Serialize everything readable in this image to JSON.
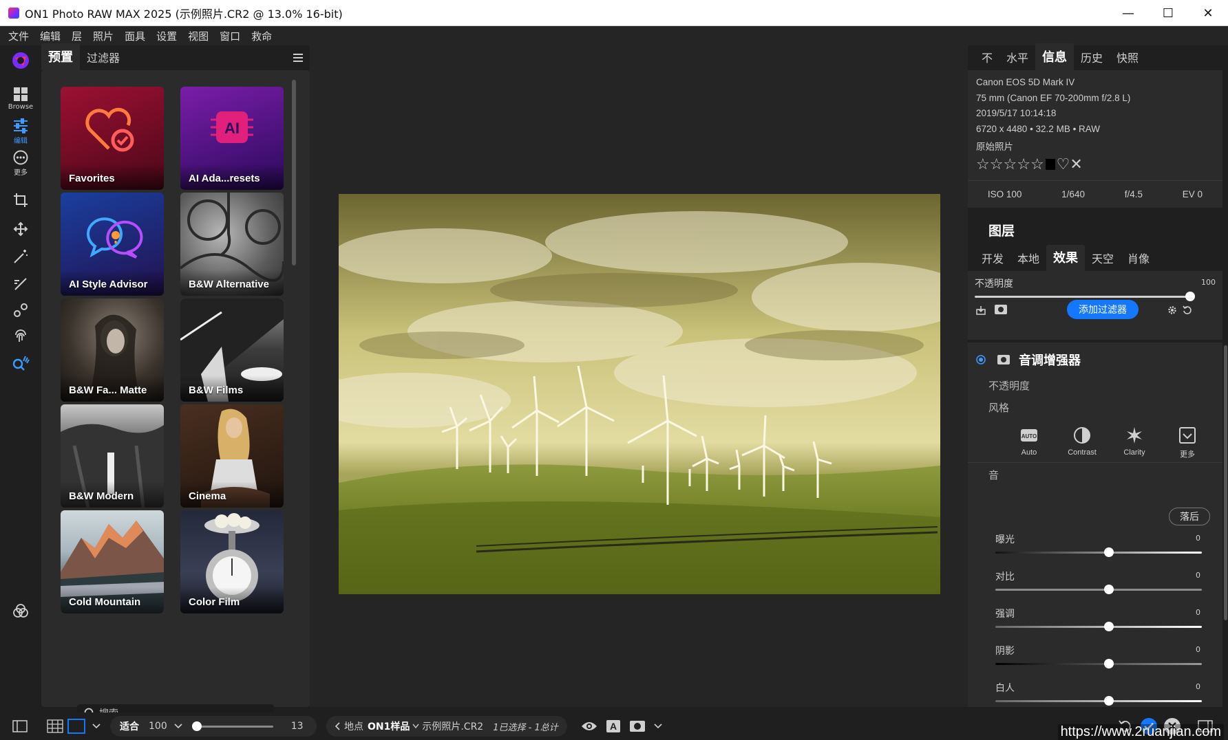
{
  "window": {
    "title": "ON1 Photo RAW MAX 2025 (示例照片.CR2 @ 13.0% 16-bit)",
    "minimize": "—",
    "maximize": "☐",
    "close": "✕"
  },
  "menu": [
    "文件",
    "编辑",
    "层",
    "照片",
    "面具",
    "设置",
    "视图",
    "窗口",
    "救命"
  ],
  "toolrail": {
    "browse_label": "Browse",
    "edit_label": "编辑",
    "more_label": "更多"
  },
  "presets_panel": {
    "tabs": [
      "预置",
      "过滤器"
    ],
    "presets": [
      {
        "name": "Favorites"
      },
      {
        "name": "AI Ada...resets"
      },
      {
        "name": "AI Style Advisor"
      },
      {
        "name": "B&W Alternative"
      },
      {
        "name": "B&W Fa... Matte"
      },
      {
        "name": "B&W Films"
      },
      {
        "name": "B&W Modern"
      },
      {
        "name": "Cinema"
      },
      {
        "name": "Cold Mountain"
      },
      {
        "name": "Color Film"
      }
    ],
    "search_placeholder": "搜索"
  },
  "right_panel": {
    "tabs": [
      "不",
      "水平",
      "信息",
      "历史",
      "快照"
    ],
    "info": {
      "camera": "Canon EOS 5D Mark IV",
      "lens": "75 mm (Canon EF 70-200mm f/2.8 L)",
      "datetime": "2019/5/17  10:14:18",
      "dimensions": "6720 x 4480 • 32.2 MB • RAW",
      "label": "原始照片"
    },
    "exif": [
      "ISO 100",
      "1/640",
      "f/4.5",
      "EV 0"
    ],
    "layers_title": "图层",
    "effect_tabs": [
      "开发",
      "本地",
      "效果",
      "天空",
      "肖像"
    ],
    "opacity_label": "不透明度",
    "opacity_value": "100",
    "add_filter": "添加过滤器",
    "filter": {
      "name": "音调增强器",
      "opacity_label": "不透明度",
      "style_label": "风格",
      "styles": [
        "Auto",
        "Contrast",
        "Clarity",
        "更多"
      ],
      "tone_label": "音",
      "after_button": "落后",
      "adjustments": [
        {
          "name": "曝光",
          "value": "0"
        },
        {
          "name": "对比",
          "value": "0"
        },
        {
          "name": "强调",
          "value": "0"
        },
        {
          "name": "阴影",
          "value": "0"
        },
        {
          "name": "白人",
          "value": "0"
        }
      ]
    }
  },
  "bottom": {
    "fit_label": "适合",
    "zoom_value": "100",
    "thumb_value": "13",
    "location_prefix": "地点",
    "location": "ON1样品",
    "filename": "示例照片.CR2",
    "selection": "1已选择 - 1总计"
  },
  "watermark": "https://www.2ruanjian.com",
  "colors": {
    "accent": "#1478ff",
    "active_tool": "#3d9bff"
  }
}
